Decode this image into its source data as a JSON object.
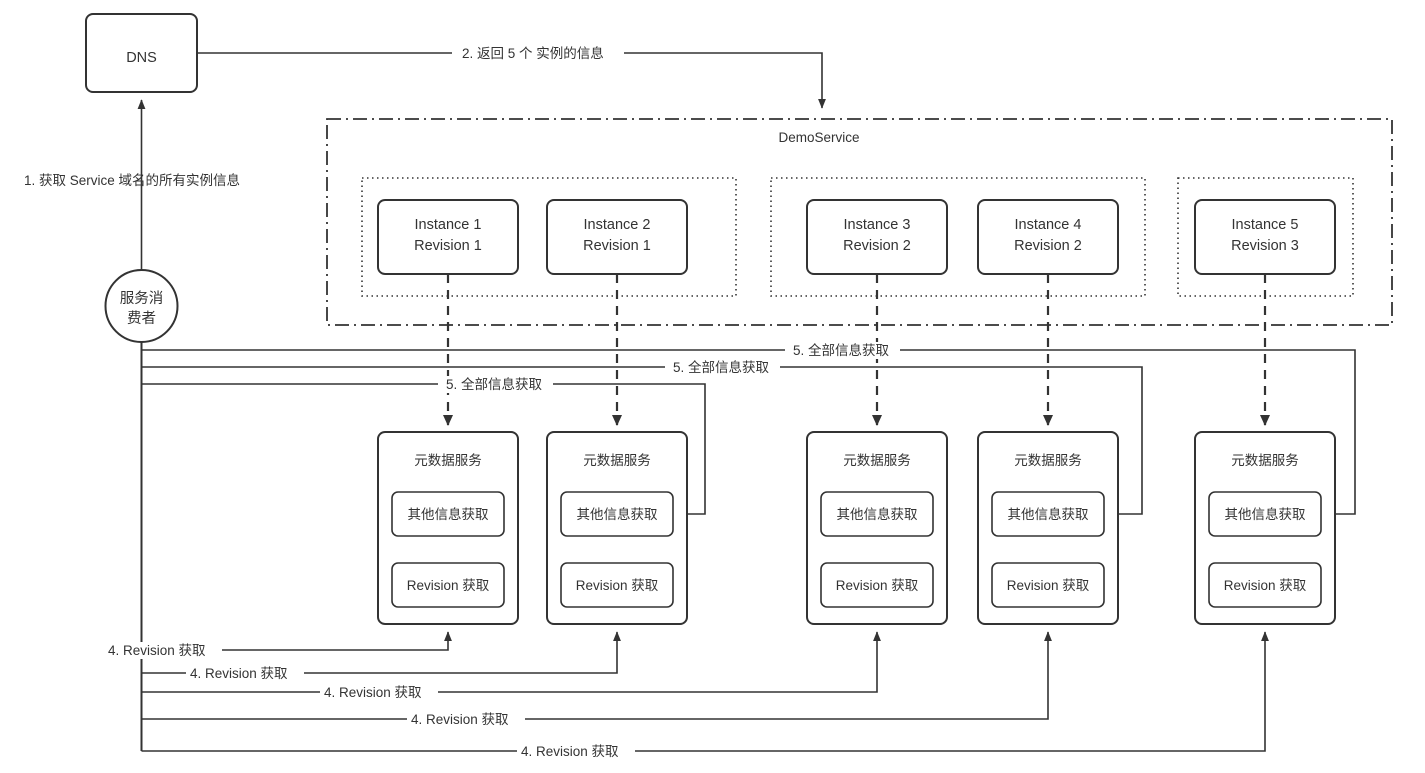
{
  "diagram": {
    "title": "DNS based service discovery with revision metadata",
    "colors": {
      "stroke": "#333333",
      "text": "#333333",
      "background": "#ffffff"
    },
    "nodes": {
      "dns": {
        "label": "DNS"
      },
      "consumer": {
        "line1": "服务消",
        "line2": "费者"
      },
      "service_group": {
        "label": "DemoService"
      }
    },
    "instances": [
      {
        "line1": "Instance 1",
        "line2": "Revision 1"
      },
      {
        "line1": "Instance 2",
        "line2": "Revision 1"
      },
      {
        "line1": "Instance 3",
        "line2": "Revision 2"
      },
      {
        "line1": "Instance 4",
        "line2": "Revision 2"
      },
      {
        "line1": "Instance 5",
        "line2": "Revision 3"
      }
    ],
    "metadata_services": [
      {
        "title": "元数据服务",
        "other": "其他信息获取",
        "revision": "Revision 获取"
      },
      {
        "title": "元数据服务",
        "other": "其他信息获取",
        "revision": "Revision 获取"
      },
      {
        "title": "元数据服务",
        "other": "其他信息获取",
        "revision": "Revision 获取"
      },
      {
        "title": "元数据服务",
        "other": "其他信息获取",
        "revision": "Revision 获取"
      },
      {
        "title": "元数据服务",
        "other": "其他信息获取",
        "revision": "Revision 获取"
      }
    ],
    "edge_labels": {
      "step1": "1. 获取 Service 域名的所有实例信息",
      "step2": "2. 返回 5 个 实例的信息",
      "step4": "4. Revision 获取",
      "step5": "5. 全部信息获取"
    },
    "steps": [
      {
        "id": "step1",
        "text": "1. 获取 Service 域名的所有实例信息"
      },
      {
        "id": "step2",
        "text": "2. 返回 5 个 实例的信息"
      },
      {
        "id": "step4a",
        "text": "4. Revision 获取"
      },
      {
        "id": "step4b",
        "text": "4. Revision 获取"
      },
      {
        "id": "step4c",
        "text": "4. Revision 获取"
      },
      {
        "id": "step4d",
        "text": "4. Revision 获取"
      },
      {
        "id": "step4e",
        "text": "4. Revision 获取"
      },
      {
        "id": "step5a",
        "text": "5. 全部信息获取"
      },
      {
        "id": "step5b",
        "text": "5. 全部信息获取"
      },
      {
        "id": "step5c",
        "text": "5. 全部信息获取"
      }
    ]
  }
}
